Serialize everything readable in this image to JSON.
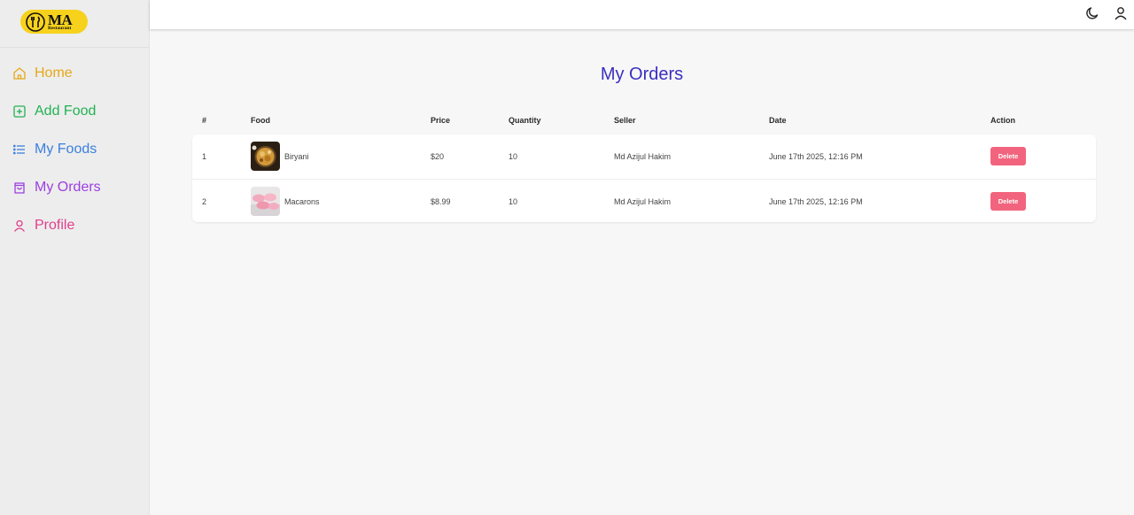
{
  "brand": {
    "logo_text": "MA",
    "logo_subtext": "Restaurant",
    "logo_color": "#f7d21c"
  },
  "sidebar": {
    "items": [
      {
        "label": "Home",
        "icon": "home-icon",
        "color": "#e6a817"
      },
      {
        "label": "Add Food",
        "icon": "plus-square-icon",
        "color": "#22b254"
      },
      {
        "label": "My Foods",
        "icon": "list-icon",
        "color": "#3b7fe0"
      },
      {
        "label": "My Orders",
        "icon": "shopping-bag-icon",
        "color": "#9b3fe0"
      },
      {
        "label": "Profile",
        "icon": "user-icon",
        "color": "#e03f8a"
      }
    ]
  },
  "header": {
    "theme_icon": "moon-icon",
    "account_icon": "user-icon"
  },
  "main": {
    "title": "My Orders",
    "columns": [
      "#",
      "Food",
      "Price",
      "Quantity",
      "Seller",
      "Date",
      "Action"
    ],
    "rows": [
      {
        "index": "1",
        "food": "Biryani",
        "price": "$20",
        "quantity": "10",
        "seller": "Md Azijul Hakim",
        "date": "June 17th 2025, 12:16 PM",
        "action": "Delete"
      },
      {
        "index": "2",
        "food": "Macarons",
        "price": "$8.99",
        "quantity": "10",
        "seller": "Md Azijul Hakim",
        "date": "June 17th 2025, 12:16 PM",
        "action": "Delete"
      }
    ]
  },
  "colors": {
    "title": "#3b2fc0",
    "delete_button": "#f2647e"
  }
}
